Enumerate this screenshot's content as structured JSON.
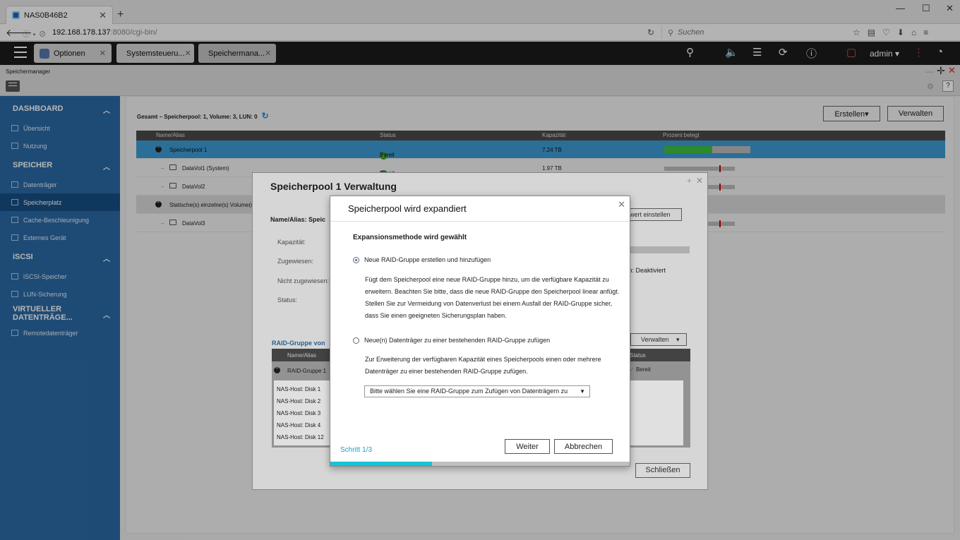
{
  "browser": {
    "tab_title": "NAS0B46B2",
    "url_host": "192.168.178.137",
    "url_rest": ":8080/cgi-bin/",
    "search_placeholder": "Suchen"
  },
  "topbar": {
    "tabs": [
      {
        "label": "Optionen"
      },
      {
        "label": "Systemsteueru..."
      },
      {
        "label": "Speichermana..."
      }
    ],
    "user": "admin ▾"
  },
  "app": {
    "title": "Speichermanager"
  },
  "sidebar": {
    "sections": [
      {
        "label": "DASHBOARD",
        "items": [
          "Übersicht",
          "Nutzung"
        ]
      },
      {
        "label": "SPEICHER",
        "items": [
          "Datenträger",
          "Speicherplatz",
          "Cache-Beschleunigung",
          "Externes Gerät"
        ]
      },
      {
        "label": "iSCSI",
        "items": [
          "iSCSI-Speicher",
          "LUN-Sicherung"
        ]
      },
      {
        "label": "VIRTUELLER DATENTRÄGE...",
        "items": [
          "Remotedatenträger"
        ]
      }
    ]
  },
  "main": {
    "summary": "Gesamt – Speicherpool: 1, Volume: 3, LUN: 0",
    "create_button": "Erstellen▾",
    "manage_button": "Verwalten",
    "columns": [
      "Name/Alias",
      "Status",
      "Kapazität",
      "Prozent belegt"
    ],
    "rows": [
      {
        "name": "Speicherpool 1",
        "status": "Bereit",
        "capacity": "7.24 TB",
        "used": 0.56
      },
      {
        "name": "DataVol1 (System)",
        "status": "Bereit",
        "capacity": "1.97 TB",
        "used": 0
      },
      {
        "name": "DataVol2",
        "status": "",
        "capacity": "",
        "used": 0
      },
      {
        "name": "Statische(s) einzelne(s) Volume(s",
        "status": "",
        "capacity": "",
        "used": 0
      },
      {
        "name": "DataVol3",
        "status": "",
        "capacity": "",
        "used": 0
      }
    ]
  },
  "pool_dialog": {
    "title": "Speicherpool 1 Verwaltung",
    "name_label": "Name/Alias: Speic",
    "threshold_button": "nwert einstellen",
    "labels": [
      "Kapazität:",
      "Zugewiesen:",
      "Nicht zugewiesen:",
      "Status:"
    ],
    "deactivated": "m:  Deaktiviert",
    "raid_heading": "RAID-Gruppe von",
    "manage_button": "Verwalten",
    "raid_columns": [
      "Name/Alias",
      "Status"
    ],
    "raid_group": "RAID-Gruppe 1",
    "raid_status": "Bereit",
    "disks": [
      "NAS-Host: Disk 1",
      "NAS-Host: Disk 2",
      "NAS-Host: Disk 3",
      "NAS-Host: Disk 4",
      "NAS-Host: Disk 12"
    ],
    "close_button": "Schließen"
  },
  "expand_dialog": {
    "title": "Speicherpool wird expandiert",
    "subtitle": "Expansionsmethode wird gewählt",
    "option1_label": "Neue RAID-Gruppe erstellen und hinzufügen",
    "option1_desc": [
      "Fügt dem Speicherpool eine neue RAID-Gruppe hinzu, um die verfügbare Kapazität zu",
      "erweitern. Beachten Sie bitte, dass die neue RAID-Gruppe den Speicherpool linear anfügt.",
      "Stellen Sie zur Vermeidung von Datenverlust bei einem Ausfall der RAID-Gruppe sicher,",
      "dass Sie einen geeigneten Sicherungsplan haben."
    ],
    "option2_label": "Neue(n) Datenträger zu einer bestehenden RAID-Gruppe zufügen",
    "option2_desc": [
      "Zur Erweiterung der verfügbaren Kapazität eines Speicherpools einen oder mehrere",
      "Datenträger zu einer bestehenden RAID-Gruppe zufügen."
    ],
    "select_value": "Bitte wählen Sie eine RAID-Gruppe zum Zufügen von Datenträgern zu",
    "step": "Schritt 1/3",
    "progress": 0.34,
    "next_button": "Weiter",
    "cancel_button": "Abbrechen"
  }
}
